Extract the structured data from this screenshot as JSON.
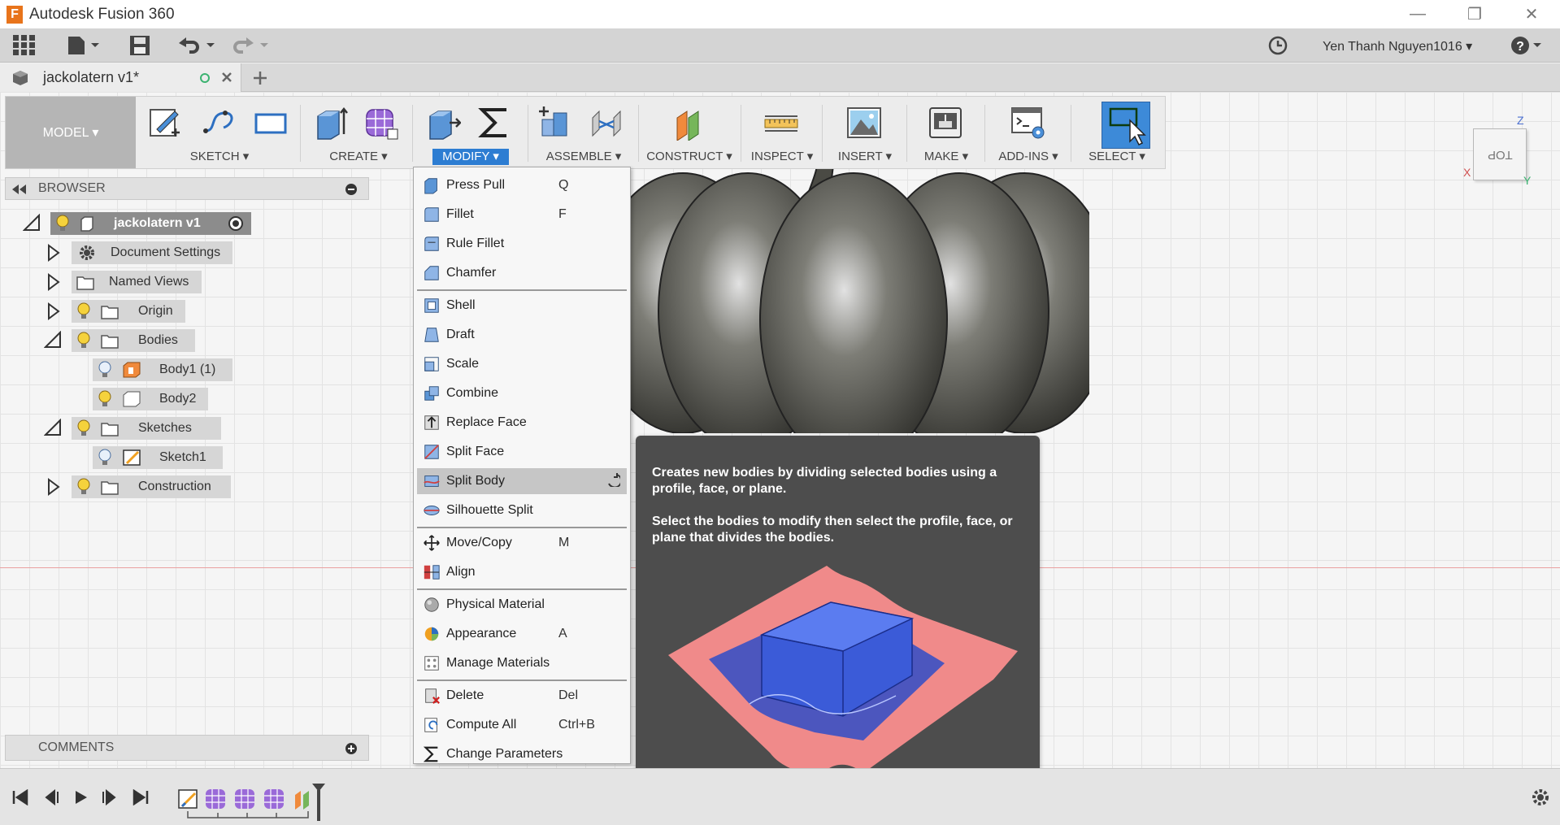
{
  "window": {
    "app_title": "Autodesk Fusion 360",
    "app_icon_letter": "F"
  },
  "qat": {
    "user_name": "Yen Thanh Nguyen1016 ▾"
  },
  "tabs": {
    "document_title": "jackolatern v1*"
  },
  "ribbon": {
    "workspace": "MODEL ▾",
    "groups": {
      "sketch": "SKETCH ▾",
      "create": "CREATE ▾",
      "modify": "MODIFY ▾",
      "assemble": "ASSEMBLE ▾",
      "construct": "CONSTRUCT ▾",
      "inspect": "INSPECT ▾",
      "insert": "INSERT ▾",
      "make": "MAKE ▾",
      "addins": "ADD-INS ▾",
      "select": "SELECT ▾"
    }
  },
  "browser": {
    "title": "BROWSER",
    "root": "jackolatern v1",
    "items": {
      "document_settings": "Document Settings",
      "named_views": "Named Views",
      "origin": "Origin",
      "bodies": "Bodies",
      "body1": "Body1 (1)",
      "body2": "Body2",
      "sketches": "Sketches",
      "sketch1": "Sketch1",
      "construction": "Construction"
    }
  },
  "comments": {
    "title": "COMMENTS"
  },
  "modify_menu": {
    "items": [
      {
        "label": "Press Pull",
        "shortcut": "Q",
        "icon": "press-pull-icon"
      },
      {
        "label": "Fillet",
        "shortcut": "F",
        "icon": "fillet-icon"
      },
      {
        "label": "Rule Fillet",
        "shortcut": "",
        "icon": "rule-fillet-icon"
      },
      {
        "label": "Chamfer",
        "shortcut": "",
        "icon": "chamfer-icon"
      },
      {
        "label": "Shell",
        "shortcut": "",
        "icon": "shell-icon"
      },
      {
        "label": "Draft",
        "shortcut": "",
        "icon": "draft-icon"
      },
      {
        "label": "Scale",
        "shortcut": "",
        "icon": "scale-icon"
      },
      {
        "label": "Combine",
        "shortcut": "",
        "icon": "combine-icon"
      },
      {
        "label": "Replace Face",
        "shortcut": "",
        "icon": "replace-face-icon"
      },
      {
        "label": "Split Face",
        "shortcut": "",
        "icon": "split-face-icon"
      },
      {
        "label": "Split Body",
        "shortcut": "",
        "icon": "split-body-icon"
      },
      {
        "label": "Silhouette Split",
        "shortcut": "",
        "icon": "silhouette-split-icon"
      },
      {
        "label": "Move/Copy",
        "shortcut": "M",
        "icon": "move-copy-icon"
      },
      {
        "label": "Align",
        "shortcut": "",
        "icon": "align-icon"
      },
      {
        "label": "Physical Material",
        "shortcut": "",
        "icon": "physical-material-icon"
      },
      {
        "label": "Appearance",
        "shortcut": "A",
        "icon": "appearance-icon"
      },
      {
        "label": "Manage Materials",
        "shortcut": "",
        "icon": "manage-materials-icon"
      },
      {
        "label": "Delete",
        "shortcut": "Del",
        "icon": "delete-icon"
      },
      {
        "label": "Compute All",
        "shortcut": "Ctrl+B",
        "icon": "compute-all-icon"
      },
      {
        "label": "Change Parameters",
        "shortcut": "",
        "icon": "change-parameters-icon"
      }
    ],
    "selected": "Split Body"
  },
  "tooltip": {
    "line1": "Creates new bodies by dividing selected bodies using a profile, face, or plane.",
    "line2": "Select the bodies to modify then select the profile, face, or plane that divides the bodies."
  },
  "viewcube": {
    "face": "TOP",
    "axis_x": "X",
    "axis_z": "Z",
    "axis_y": "Y"
  },
  "colors": {
    "accent_blue": "#2d7dd2",
    "tooltip_bg": "#4d4d4d",
    "split_plane_pink": "#f08a8a",
    "body_blue": "#3b5bc4"
  }
}
